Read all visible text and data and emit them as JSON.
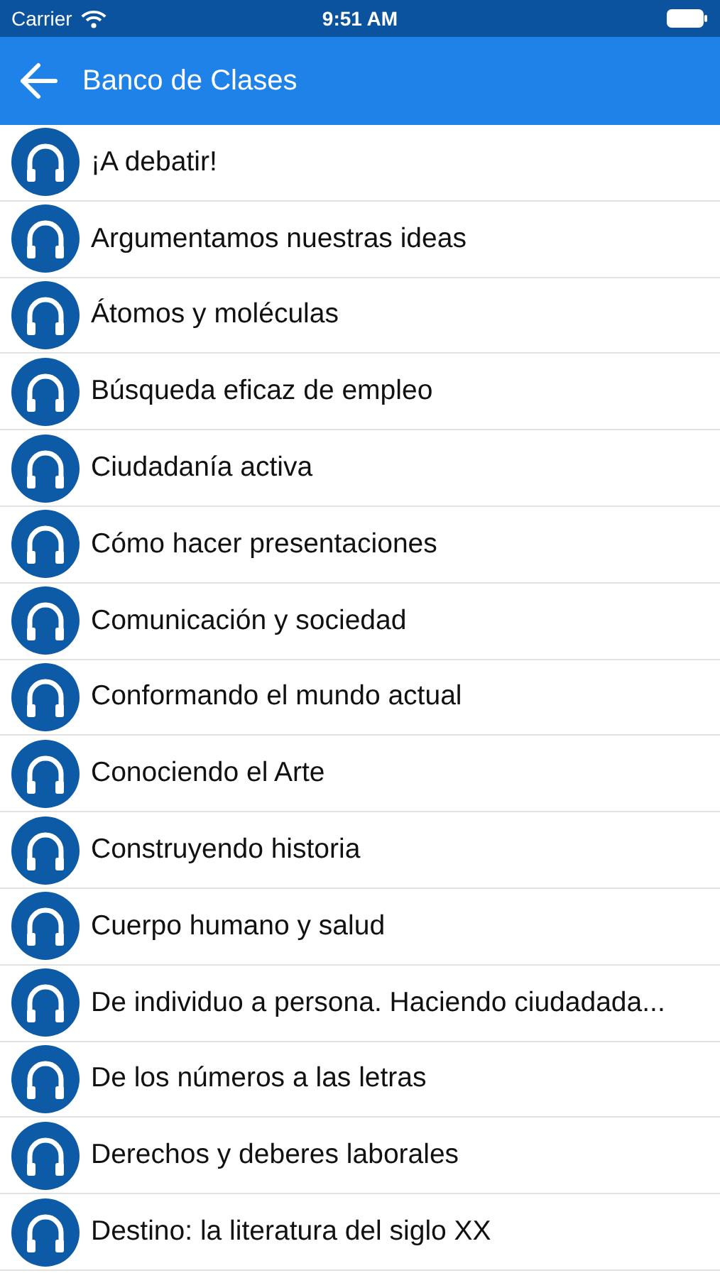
{
  "status_bar": {
    "carrier": "Carrier",
    "time": "9:51 AM"
  },
  "nav_bar": {
    "title": "Banco de Clases"
  },
  "items": [
    {
      "title": "¡A debatir!"
    },
    {
      "title": "Argumentamos nuestras ideas"
    },
    {
      "title": "Átomos y moléculas"
    },
    {
      "title": "Búsqueda eficaz de empleo"
    },
    {
      "title": "Ciudadanía activa"
    },
    {
      "title": "Cómo hacer presentaciones"
    },
    {
      "title": "Comunicación y sociedad"
    },
    {
      "title": "Conformando el mundo actual"
    },
    {
      "title": "Conociendo el Arte"
    },
    {
      "title": "Construyendo historia"
    },
    {
      "title": "Cuerpo humano y salud"
    },
    {
      "title": "De individuo a persona. Haciendo ciudadada..."
    },
    {
      "title": "De los números a las letras"
    },
    {
      "title": "Derechos y deberes laborales"
    },
    {
      "title": "Destino: la literatura del siglo XX"
    }
  ]
}
